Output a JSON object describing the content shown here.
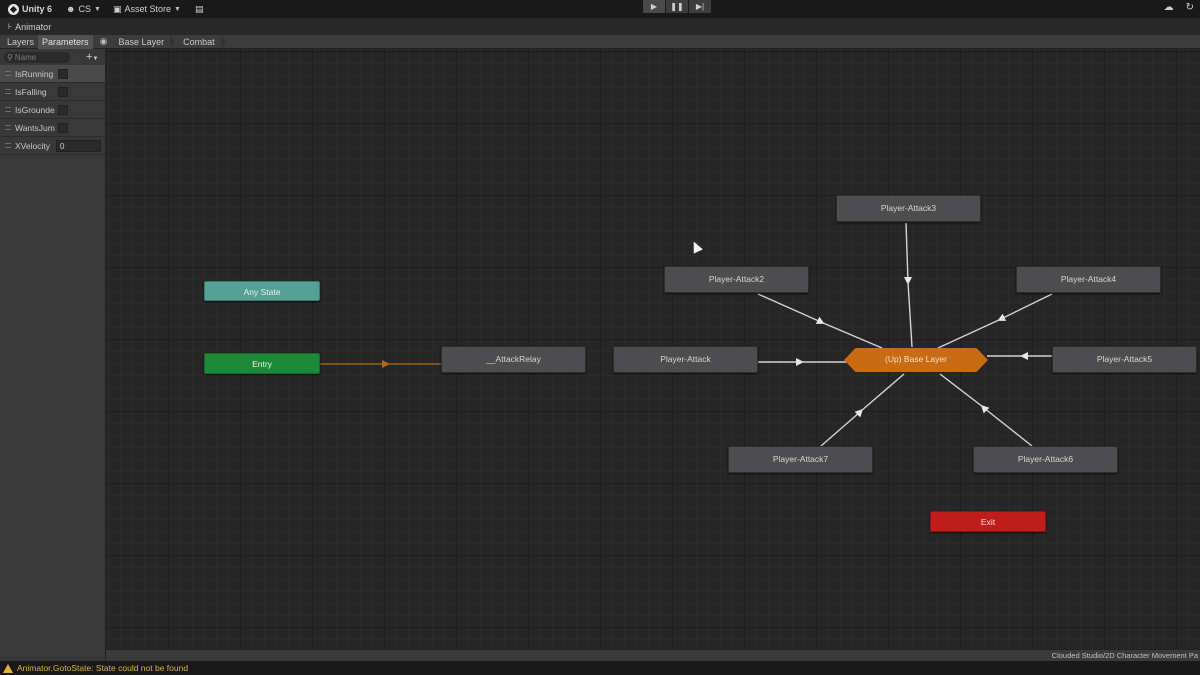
{
  "toolbar": {
    "account": "Unity 6",
    "user": "CS",
    "asset_store": "Asset Store"
  },
  "window": {
    "tab_title": "Animator"
  },
  "subbar": {
    "tabs": [
      {
        "label": "Layers",
        "active": false
      },
      {
        "label": "Parameters",
        "active": true
      }
    ],
    "breadcrumbs": [
      "Base Layer",
      "Combat"
    ]
  },
  "parameters": {
    "search_placeholder": "Name",
    "items": [
      {
        "name": "IsRunning",
        "type": "bool"
      },
      {
        "name": "IsFalling",
        "type": "bool"
      },
      {
        "name": "IsGrounde",
        "type": "bool"
      },
      {
        "name": "WantsJum",
        "type": "bool"
      },
      {
        "name": "XVelocity",
        "type": "float",
        "value": "0"
      }
    ]
  },
  "graph": {
    "nodes": {
      "any_state": "Any State",
      "entry": "Entry",
      "attack_relay": "__AttackRelay",
      "player_attack": "Player-Attack",
      "player_attack2": "Player-Attack2",
      "player_attack3": "Player-Attack3",
      "player_attack4": "Player-Attack4",
      "player_attack5": "Player-Attack5",
      "player_attack6": "Player-Attack6",
      "player_attack7": "Player-Attack7",
      "up_base_layer": "(Up) Base Layer",
      "exit": "Exit"
    },
    "colors": {
      "any_state": "#55a196",
      "entry": "#1c8a36",
      "exit": "#c01c1c",
      "up_state": "#c86b12",
      "default_transition": "#b36a14"
    }
  },
  "footer": {
    "asset_path": "Clouded Studio/2D Character Movement Pa"
  },
  "status": {
    "message": "Animator.GotoState: State could not be found"
  }
}
